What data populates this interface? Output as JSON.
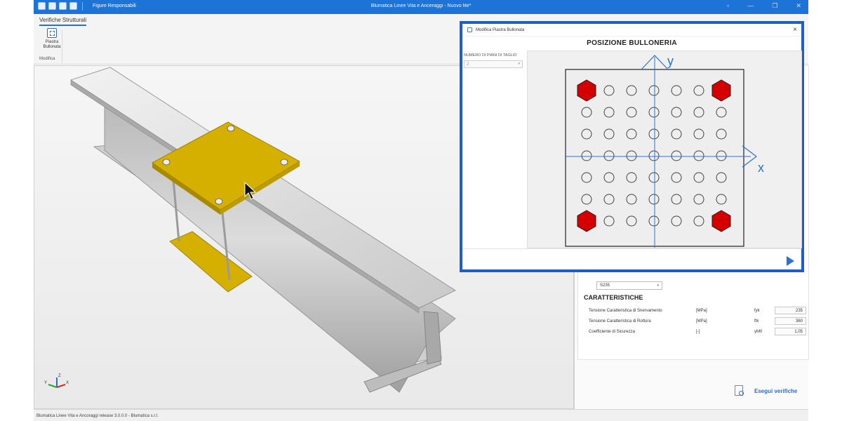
{
  "window": {
    "title": "Blumatica Linee Vita e Anceraggi - Nuovo file*",
    "toolbar_figure_label": "Figure Responsabili",
    "controls": [
      "▫",
      "—",
      "❐",
      "✕"
    ]
  },
  "ribbon": {
    "tab": "Verifiche Strutturali",
    "button_label_line1": "Piastra",
    "button_label_line2": "Bullonata",
    "group_label": "Modifica"
  },
  "dialog": {
    "title": "Modifica Piastra Bullonata",
    "close": "×",
    "heading": "POSIZIONE BULLONERIA",
    "field_label": "NUMERO DI PIANI DI TAGLIO",
    "field_value": "2",
    "axis_x": "x",
    "axis_y": "y",
    "grid_rows": 7,
    "grid_cols": 7,
    "bolt_color": "#d40000",
    "hole_stroke": "#444444",
    "axis_color": "#2a72d6"
  },
  "properties": {
    "material": "S235",
    "section_title": "CARATTERISTICHE",
    "rows": [
      {
        "name": "Tensione Caratteristica di Snervamento",
        "unit": "[MPa]",
        "symbol": "fyk",
        "value": "235"
      },
      {
        "name": "Tensione Caratteristica di Rottura",
        "unit": "[MPa]",
        "symbol": "ftk",
        "value": "360"
      },
      {
        "name": "Coefficiente di Sicurezza",
        "unit": "[-]",
        "symbol": "γM0",
        "value": "1,05"
      }
    ]
  },
  "run_button": "Esegui verifiche",
  "status": "Blumatica Linee Vita e Ancoraggi release 3.0.0.0 - Blumatica s.r.l.",
  "axes_widget": {
    "x": "X",
    "y": "Y",
    "z": "Z"
  },
  "colors": {
    "titlebar": "#1e73d6",
    "plate": "#d6b000",
    "dialog_border": "#1f5fc5"
  }
}
